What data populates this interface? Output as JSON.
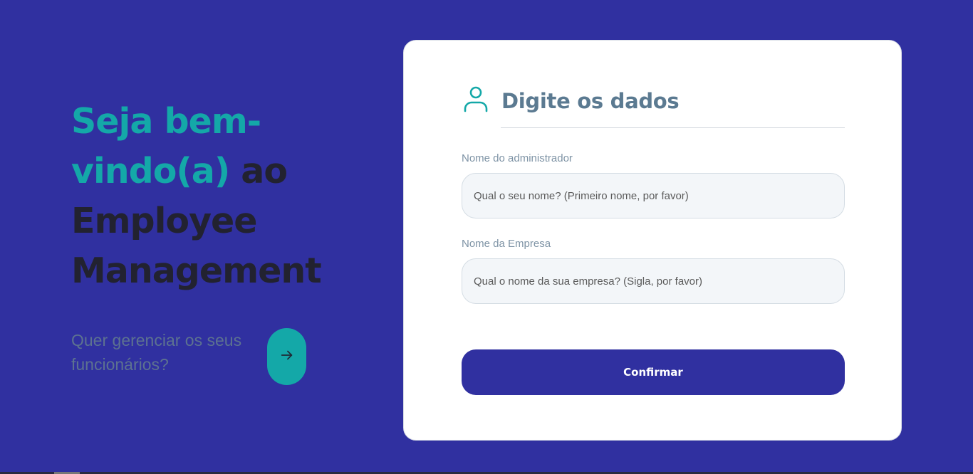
{
  "hero": {
    "title_accent": "Seja bem-vindo(a)",
    "title_rest": " ao Employee Management",
    "cta_text": "Quer gerenciar os seus funcionários?",
    "cta_icon": "arrow-right-icon"
  },
  "form": {
    "header_icon": "user-icon",
    "title": "Digite os dados",
    "admin": {
      "label": "Nome do administrador",
      "placeholder": "Qual o seu nome? (Primeiro nome, por favor)",
      "value": ""
    },
    "company": {
      "label": "Nome da Empresa",
      "placeholder": "Qual o nome da sua empresa? (Sigla, por favor)",
      "value": ""
    },
    "confirm_label": "Confirmar"
  },
  "colors": {
    "background": "#3030a0",
    "accent": "#14a8a8",
    "card": "#ffffff",
    "title_text": "#5b7a91"
  }
}
